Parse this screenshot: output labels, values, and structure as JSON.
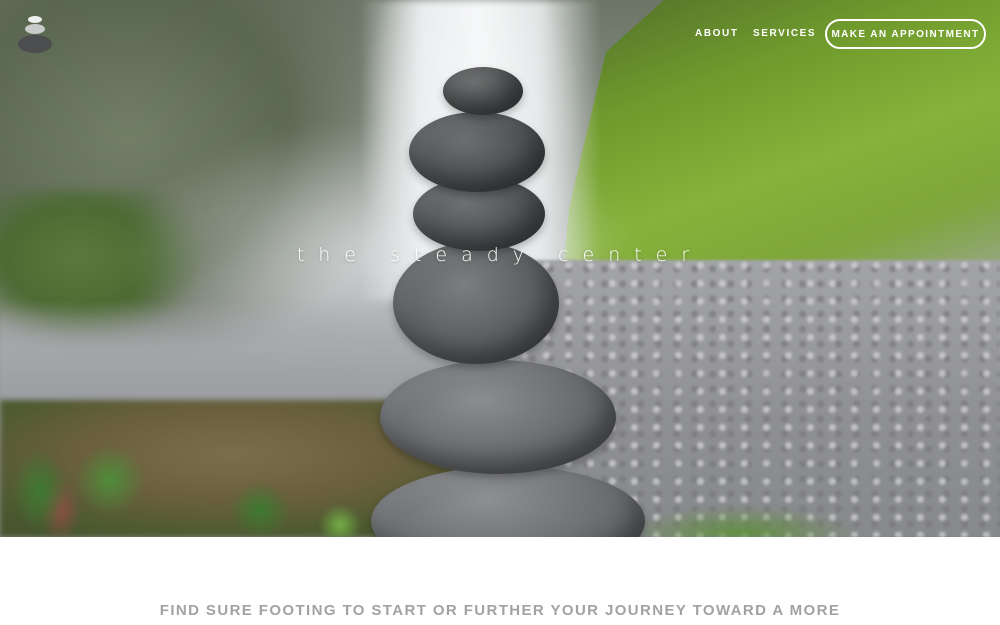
{
  "brand": {
    "logo_icon": "stacked-stones-logo",
    "site_title": "the steady center"
  },
  "nav": {
    "about": "ABOUT",
    "services": "SERVICES",
    "appointment_button": "MAKE AN APPOINTMENT"
  },
  "hero": {
    "image": "stacked-stones-waterfall-photo"
  },
  "intro": {
    "tagline": "FIND SURE FOOTING TO START OR FURTHER YOUR JOURNEY TOWARD A MORE"
  },
  "colors": {
    "nav_text": "#ffffff",
    "tagline_text": "#a2a2a2",
    "page_background": "#ffffff"
  }
}
